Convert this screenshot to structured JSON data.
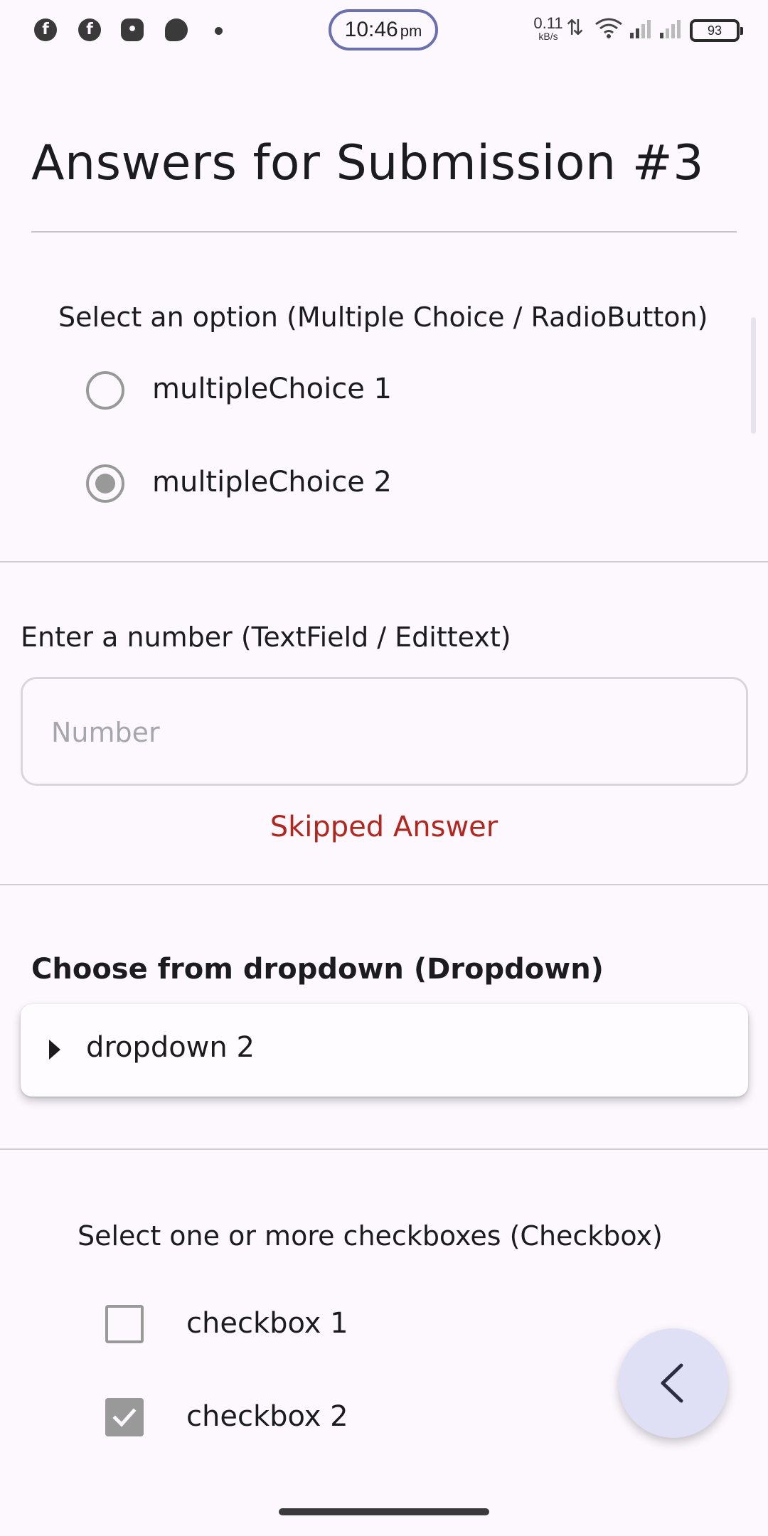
{
  "status_bar": {
    "time": "10:46",
    "ampm": "pm",
    "net_speed_value": "0.11",
    "net_speed_unit": "kB/s",
    "battery": "93",
    "icons": [
      "facebook-icon",
      "facebook-icon",
      "discord-icon",
      "chat-bubble-icon",
      "notification-dot-icon",
      "wifi-icon",
      "signal-icon",
      "signal-icon",
      "battery-icon"
    ]
  },
  "page": {
    "title": "Answers for Submission #3"
  },
  "radio_question": {
    "text": "Select an option (Multiple Choice / RadioButton)",
    "options": [
      {
        "label": "multipleChoice 1",
        "selected": false
      },
      {
        "label": "multipleChoice 2",
        "selected": true
      }
    ]
  },
  "number_question": {
    "text": "Enter a number (TextField / Edittext)",
    "placeholder": "Number",
    "value": "",
    "status": "Skipped Answer"
  },
  "dropdown_question": {
    "text": "Choose from dropdown (Dropdown)",
    "selected": "dropdown 2"
  },
  "checkbox_question": {
    "text": "Select one or more checkboxes (Checkbox)",
    "options": [
      {
        "label": "checkbox 1",
        "checked": false
      },
      {
        "label": "checkbox 2",
        "checked": true
      }
    ]
  },
  "fab": {
    "icon": "chevron-left-icon"
  },
  "colors": {
    "background": "#fcf8fe",
    "error": "#b3261e",
    "control_gray": "#999999",
    "fab": "#dfe0f6"
  }
}
